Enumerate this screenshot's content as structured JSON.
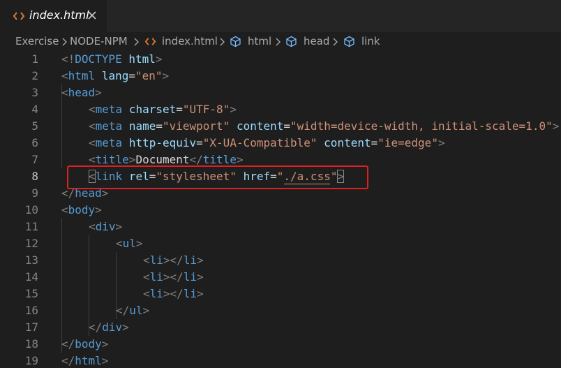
{
  "tab": {
    "label": "index.html",
    "file_icon": "html-file-icon",
    "close_icon": "close-icon"
  },
  "breadcrumb": {
    "items": [
      {
        "label": "Exercise",
        "icon": null
      },
      {
        "label": "NODE-NPM",
        "icon": null
      },
      {
        "label": "index.html",
        "icon": "html-file-icon"
      },
      {
        "label": "html",
        "icon": "element-cube-icon"
      },
      {
        "label": "head",
        "icon": "element-cube-icon"
      },
      {
        "label": "link",
        "icon": "element-cube-icon"
      }
    ]
  },
  "editor": {
    "lines": [
      {
        "n": "1",
        "indent": 0,
        "tokens": [
          [
            "t-punct",
            "<!"
          ],
          [
            "t-tag",
            "DOCTYPE "
          ],
          [
            "t-attr",
            "html"
          ],
          [
            "t-punct",
            ">"
          ]
        ]
      },
      {
        "n": "2",
        "indent": 0,
        "tokens": [
          [
            "t-punct",
            "<"
          ],
          [
            "t-tag",
            "html "
          ],
          [
            "t-attr",
            "lang"
          ],
          [
            "t-text",
            "="
          ],
          [
            "t-str",
            "\"en\""
          ],
          [
            "t-punct",
            ">"
          ]
        ]
      },
      {
        "n": "3",
        "indent": 0,
        "tokens": [
          [
            "t-punct",
            "<"
          ],
          [
            "t-tag",
            "head"
          ],
          [
            "t-punct",
            ">"
          ]
        ]
      },
      {
        "n": "4",
        "indent": 1,
        "tokens": [
          [
            "t-punct",
            "<"
          ],
          [
            "t-tag",
            "meta "
          ],
          [
            "t-attr",
            "charset"
          ],
          [
            "t-text",
            "="
          ],
          [
            "t-str",
            "\"UTF-8\""
          ],
          [
            "t-punct",
            ">"
          ]
        ]
      },
      {
        "n": "5",
        "indent": 1,
        "tokens": [
          [
            "t-punct",
            "<"
          ],
          [
            "t-tag",
            "meta "
          ],
          [
            "t-attr",
            "name"
          ],
          [
            "t-text",
            "="
          ],
          [
            "t-str",
            "\"viewport\" "
          ],
          [
            "t-attr",
            "content"
          ],
          [
            "t-text",
            "="
          ],
          [
            "t-str",
            "\"width=device-width, initial-scale=1.0\""
          ],
          [
            "t-punct",
            ">"
          ]
        ]
      },
      {
        "n": "6",
        "indent": 1,
        "tokens": [
          [
            "t-punct",
            "<"
          ],
          [
            "t-tag",
            "meta "
          ],
          [
            "t-attr",
            "http-equiv"
          ],
          [
            "t-text",
            "="
          ],
          [
            "t-str",
            "\"X-UA-Compatible\" "
          ],
          [
            "t-attr",
            "content"
          ],
          [
            "t-text",
            "="
          ],
          [
            "t-str",
            "\"ie=edge\""
          ],
          [
            "t-punct",
            ">"
          ]
        ]
      },
      {
        "n": "7",
        "indent": 1,
        "tokens": [
          [
            "t-punct",
            "<"
          ],
          [
            "t-tag",
            "title"
          ],
          [
            "t-punct",
            ">"
          ],
          [
            "t-text",
            "Document"
          ],
          [
            "t-punct",
            "</"
          ],
          [
            "t-tag",
            "title"
          ],
          [
            "t-punct",
            ">"
          ]
        ]
      },
      {
        "n": "8",
        "indent": 1,
        "active": true,
        "tokens": [
          [
            "t-punct",
            "<"
          ],
          [
            "t-tag",
            "link "
          ],
          [
            "t-attr",
            "rel"
          ],
          [
            "t-text",
            "="
          ],
          [
            "t-str",
            "\"stylesheet\" "
          ],
          [
            "t-attr",
            "href"
          ],
          [
            "t-text",
            "="
          ],
          [
            "t-str",
            "\"./a.css\""
          ],
          [
            "t-punct",
            ">"
          ]
        ]
      },
      {
        "n": "9",
        "indent": 0,
        "tokens": [
          [
            "t-punct",
            "</"
          ],
          [
            "t-tag",
            "head"
          ],
          [
            "t-punct",
            ">"
          ]
        ]
      },
      {
        "n": "10",
        "indent": 0,
        "tokens": [
          [
            "t-punct",
            "<"
          ],
          [
            "t-tag",
            "body"
          ],
          [
            "t-punct",
            ">"
          ]
        ]
      },
      {
        "n": "11",
        "indent": 1,
        "tokens": [
          [
            "t-punct",
            "<"
          ],
          [
            "t-tag",
            "div"
          ],
          [
            "t-punct",
            ">"
          ]
        ]
      },
      {
        "n": "12",
        "indent": 2,
        "tokens": [
          [
            "t-punct",
            "<"
          ],
          [
            "t-tag",
            "ul"
          ],
          [
            "t-punct",
            ">"
          ]
        ]
      },
      {
        "n": "13",
        "indent": 3,
        "tokens": [
          [
            "t-punct",
            "<"
          ],
          [
            "t-tag",
            "li"
          ],
          [
            "t-punct",
            "></"
          ],
          [
            "t-tag",
            "li"
          ],
          [
            "t-punct",
            ">"
          ]
        ]
      },
      {
        "n": "14",
        "indent": 3,
        "tokens": [
          [
            "t-punct",
            "<"
          ],
          [
            "t-tag",
            "li"
          ],
          [
            "t-punct",
            "></"
          ],
          [
            "t-tag",
            "li"
          ],
          [
            "t-punct",
            ">"
          ]
        ]
      },
      {
        "n": "15",
        "indent": 3,
        "tokens": [
          [
            "t-punct",
            "<"
          ],
          [
            "t-tag",
            "li"
          ],
          [
            "t-punct",
            "></"
          ],
          [
            "t-tag",
            "li"
          ],
          [
            "t-punct",
            ">"
          ]
        ]
      },
      {
        "n": "16",
        "indent": 2,
        "tokens": [
          [
            "t-punct",
            "</"
          ],
          [
            "t-tag",
            "ul"
          ],
          [
            "t-punct",
            ">"
          ]
        ]
      },
      {
        "n": "17",
        "indent": 1,
        "tokens": [
          [
            "t-punct",
            "</"
          ],
          [
            "t-tag",
            "div"
          ],
          [
            "t-punct",
            ">"
          ]
        ]
      },
      {
        "n": "18",
        "indent": 0,
        "tokens": [
          [
            "t-punct",
            "</"
          ],
          [
            "t-tag",
            "body"
          ],
          [
            "t-punct",
            ">"
          ]
        ]
      },
      {
        "n": "19",
        "indent": 0,
        "tokens": [
          [
            "t-punct",
            "</"
          ],
          [
            "t-tag",
            "html"
          ],
          [
            "t-punct",
            ">"
          ]
        ]
      }
    ],
    "highlight_color": "#e02020"
  }
}
